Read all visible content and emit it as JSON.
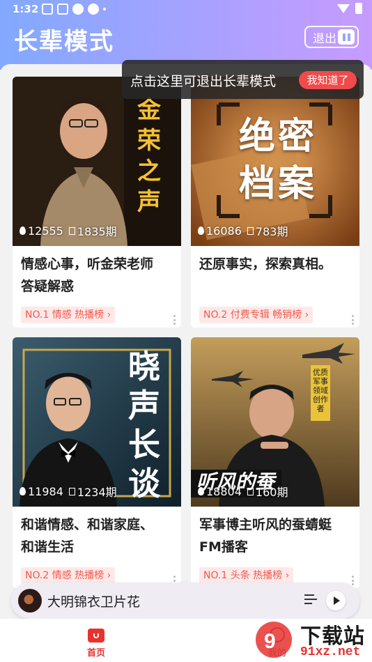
{
  "status": {
    "time": "1:32"
  },
  "header": {
    "title": "长辈模式",
    "exit_label": "退出"
  },
  "tooltip": {
    "text": "点击这里可退出长辈模式",
    "button": "我知道了"
  },
  "cards": [
    {
      "cover_text": "金荣之声",
      "plays": "12555",
      "episodes": "1835期",
      "title": "情感心事，听金荣老师答疑解惑",
      "tag": "NO.1 情感 热播榜 ›"
    },
    {
      "cover_text": "绝密档案",
      "plays": "16086",
      "episodes": "783期",
      "title": "还原事实，探索真相。",
      "tag": "NO.2 付费专辑 畅销榜 ›"
    },
    {
      "cover_text": "晓声长谈",
      "plays": "11984",
      "episodes": "1234期",
      "title": "和谐情感、和谐家庭、和谐生活",
      "tag": "NO.2 情感 热播榜 ›"
    },
    {
      "cover_text": "听风的蚕",
      "cover_badge": "优质军事领域创作者",
      "plays": "18804",
      "episodes": "160期",
      "title": "军事博主听风的蚕蜻蜓FM播客",
      "tag": "NO.1 头条 热播榜 ›"
    }
  ],
  "mini_player": {
    "title": "大明锦衣卫片花"
  },
  "tabbar": {
    "home": "首页",
    "mine": "我的"
  },
  "watermark": {
    "main": "下载站",
    "sub": "91xz.net"
  },
  "colors": {
    "accent": "#e8322f",
    "header_start": "#82a9ff",
    "header_end": "#c79bff"
  }
}
